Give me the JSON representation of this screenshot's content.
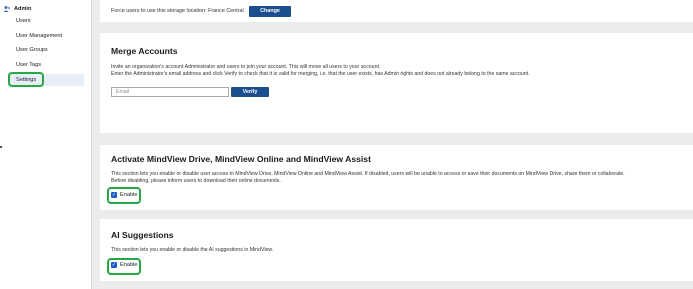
{
  "sidebar": {
    "section_label": "Admin",
    "items": [
      {
        "label": "Users"
      },
      {
        "label": "User Management"
      },
      {
        "label": "User Groups"
      },
      {
        "label": "User Tags"
      },
      {
        "label": "Settings"
      }
    ]
  },
  "storage": {
    "text": "Force users to use this storage location: France Central",
    "change_label": "Change"
  },
  "merge": {
    "title": "Merge Accounts",
    "line1": "Invite an organization's account Administrator and users to join your account. This will move all users to your account.",
    "line2": "Enter the Administrator's email address and click Verify to check that it is valid for merging, i.e. that the user exists, has Admin rights and does not already belong to the same account.",
    "email_placeholder": "Email",
    "verify_label": "Verify"
  },
  "drive": {
    "title": "Activate MindView Drive, MindView Online and MindView Assist",
    "line1": "This section lets you enable or disable user access to MindView Drive, MindView Online and MindView Assist. If disabled, users will be unable to access or save their documents on MindView Drive, share them or collaborate.",
    "line2": "Before disabling, please inform users to download their online documents.",
    "enable_label": "Enable"
  },
  "ai": {
    "title": "AI Suggestions",
    "line1": "This section lets you enable or disable the AI suggestions in MindView.",
    "enable_label": "Enable"
  },
  "colors": {
    "accent": "#1a4e8f",
    "highlight": "#27a844",
    "checkbox": "#1a5fc8"
  }
}
